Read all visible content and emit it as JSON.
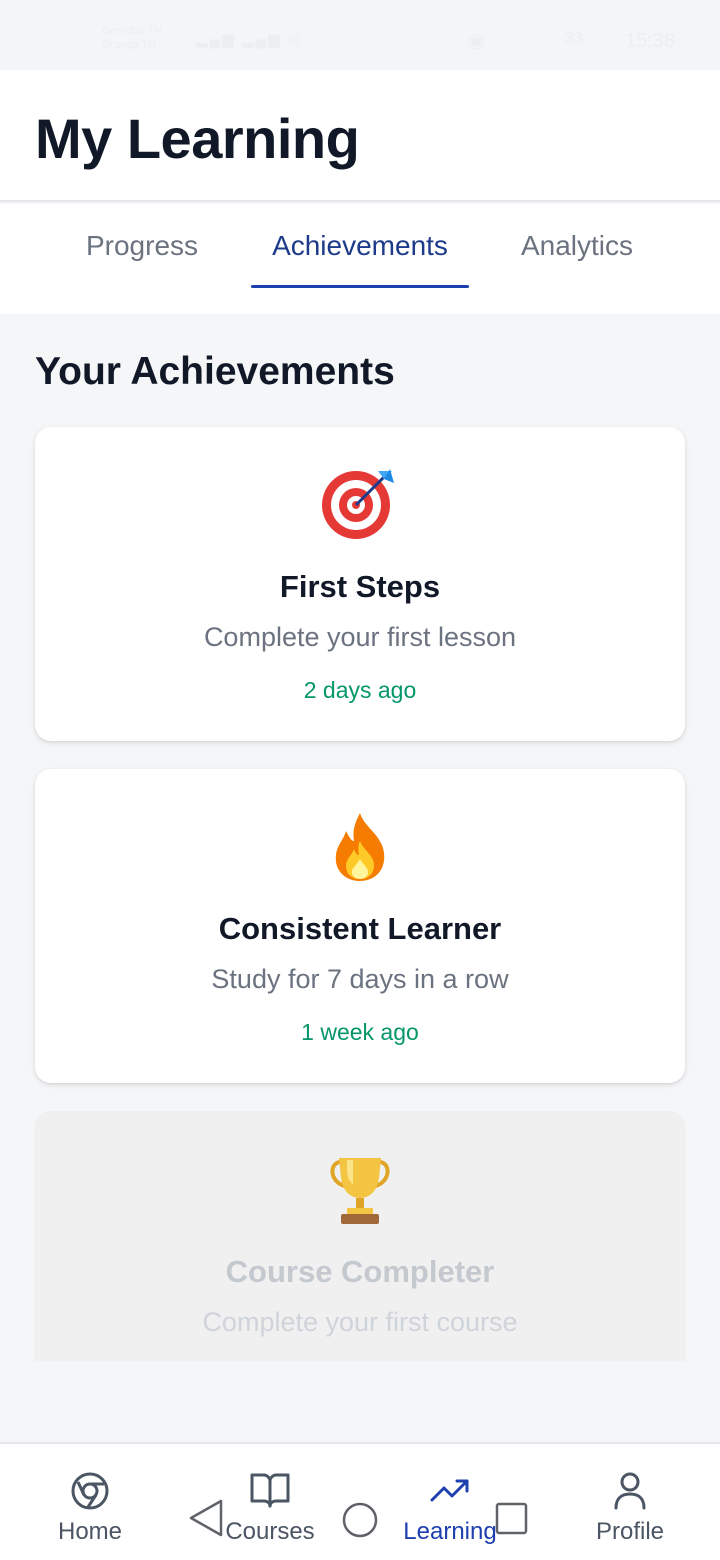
{
  "status_bar": {
    "carrier_line1": "Ooredoo TN",
    "carrier_line2": "Orange TN",
    "battery": "33",
    "time": "15:38"
  },
  "header": {
    "title": "My Learning"
  },
  "tabs": [
    {
      "label": "Progress",
      "active": false
    },
    {
      "label": "Achievements",
      "active": true
    },
    {
      "label": "Analytics",
      "active": false
    }
  ],
  "section_title": "Your Achievements",
  "achievements": [
    {
      "icon": "dart-target-icon",
      "name": "First Steps",
      "description": "Complete your first lesson",
      "earned": "2 days ago",
      "unlocked": true
    },
    {
      "icon": "fire-icon",
      "name": "Consistent Learner",
      "description": "Study for 7 days in a row",
      "earned": "1 week ago",
      "unlocked": true
    },
    {
      "icon": "trophy-icon",
      "name": "Course Completer",
      "description": "Complete your first course",
      "earned": "",
      "unlocked": false
    }
  ],
  "bottom_nav": [
    {
      "label": "Home",
      "icon": "compass-icon",
      "active": false
    },
    {
      "label": "Courses",
      "icon": "book-icon",
      "active": false
    },
    {
      "label": "Learning",
      "icon": "trending-up-icon",
      "active": true
    },
    {
      "label": "Profile",
      "icon": "user-icon",
      "active": false
    }
  ],
  "colors": {
    "accent": "#1e40af",
    "success": "#059669",
    "text_primary": "#111827",
    "text_secondary": "#6b7280",
    "background": "#f5f6f8"
  }
}
